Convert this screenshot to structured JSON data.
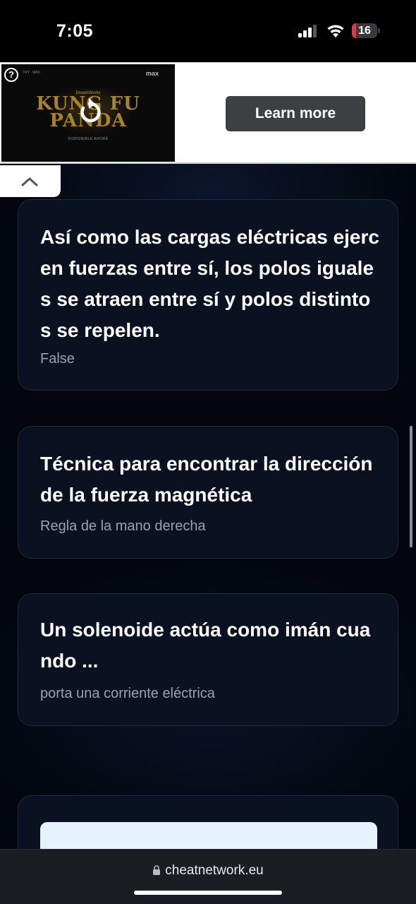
{
  "status_bar": {
    "time": "7:05",
    "battery_level": "16",
    "battery_fraction": 0.16
  },
  "ad": {
    "logo_top": "DreamWorks",
    "logo": "KUNG FU PANDA",
    "top_line": "TRY · MAX ·",
    "brand": "max",
    "caption": "DISPONIBLE AHORA",
    "help": "?",
    "button_label": "Learn more"
  },
  "cards": [
    {
      "question": "Así como las cargas eléctricas ejercen fuerzas entre sí, los polos iguales se atraen entre sí y polos distintos se repelen.",
      "answer": "False"
    },
    {
      "question": "Técnica para encontrar la dirección de la fuerza magnética",
      "answer": "Regla de la mano derecha"
    },
    {
      "question": "Un solenoide actúa como imán cuando ...",
      "answer": "porta una corriente eléctrica"
    }
  ],
  "browser": {
    "url": "cheatnetwork.eu"
  },
  "colors": {
    "background": "#03060d",
    "card_bg": "#0a1120",
    "card_border": "#1f2a3e",
    "answer_text": "#9aa2b2",
    "battery_red": "#e0393e"
  },
  "icons": [
    "signal-icon",
    "wifi-icon",
    "battery-icon",
    "help-icon",
    "replay-icon",
    "chevron-up-icon",
    "lock-icon"
  ]
}
